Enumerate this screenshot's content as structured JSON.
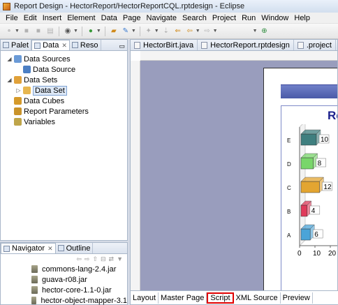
{
  "window": {
    "title": "Report Design - HectorReport/HectorReportCQL.rptdesign - Eclipse"
  },
  "menu": [
    "File",
    "Edit",
    "Insert",
    "Element",
    "Data",
    "Page",
    "Navigate",
    "Search",
    "Project",
    "Run",
    "Window",
    "Help"
  ],
  "left_top": {
    "tabs": [
      {
        "label": "Palet",
        "active": false
      },
      {
        "label": "Data",
        "active": true
      },
      {
        "label": "Reso",
        "active": false
      }
    ],
    "tree": [
      {
        "label": "Data Sources",
        "level": 0,
        "expand": "open",
        "icon_color": "#6a9ad6"
      },
      {
        "label": "Data Source",
        "level": 1,
        "expand": "",
        "icon_color": "#4c7fc4"
      },
      {
        "label": "Data Sets",
        "level": 0,
        "expand": "open",
        "icon_color": "#e0a13a"
      },
      {
        "label": "Data Set",
        "level": 1,
        "expand": "closed",
        "icon_color": "#e7b64e",
        "selected": true
      },
      {
        "label": "Data Cubes",
        "level": 0,
        "expand": "",
        "icon_color": "#d59a2a"
      },
      {
        "label": "Report Parameters",
        "level": 0,
        "expand": "",
        "icon_color": "#c9932a"
      },
      {
        "label": "Variables",
        "level": 0,
        "expand": "",
        "icon_color": "#bfa54a"
      }
    ]
  },
  "left_bottom": {
    "tabs": [
      {
        "label": "Navigator",
        "active": true,
        "close": "x"
      },
      {
        "label": "Outline",
        "active": false,
        "close": ""
      }
    ],
    "jars": [
      "commons-lang-2.4.jar",
      "guava-r08.jar",
      "hector-core-1.1-0.jar",
      "hector-object-mapper-3.1"
    ]
  },
  "editor": {
    "tabs": [
      "HectorBirt.java",
      "HectorReport.rptdesign",
      ".project"
    ],
    "bottom_tabs": [
      {
        "label": "Layout",
        "highlight": false
      },
      {
        "label": "Master Page",
        "highlight": false
      },
      {
        "label": "Script",
        "highlight": true
      },
      {
        "label": "XML Source",
        "highlight": false
      },
      {
        "label": "Preview",
        "highlight": false
      }
    ],
    "chart_title": "Re"
  },
  "chart_data": {
    "type": "bar",
    "title": "Re",
    "categories": [
      "A",
      "B",
      "C",
      "D",
      "E"
    ],
    "values": [
      6,
      4,
      12,
      8,
      10
    ],
    "x_ticks": [
      "0",
      "10",
      "20"
    ],
    "colors": [
      "#4aa4d8",
      "#e03a5a",
      "#e3a531",
      "#79d66a",
      "#3f7f7f"
    ]
  }
}
